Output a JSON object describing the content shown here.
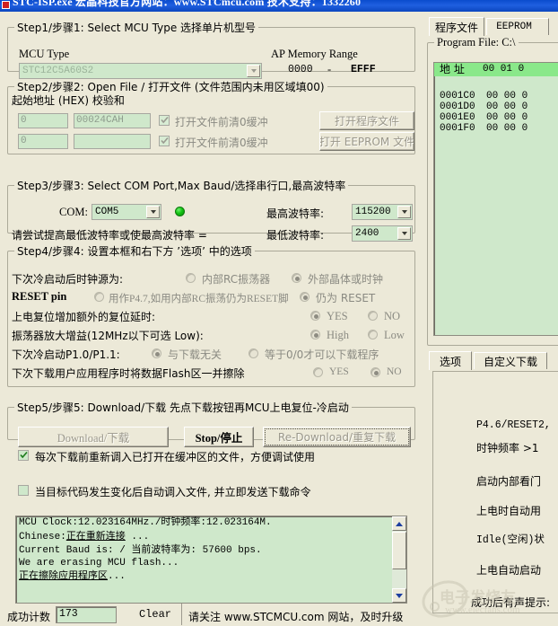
{
  "window": {
    "title": "STC-ISP.exe    宏晶科技官方网站：www.STCmcu.com   技术支持：1332260"
  },
  "step1": {
    "legend": "Step1/步骤1: Select MCU Type  选择单片机型号",
    "mcu_type_label": "MCU Type",
    "mcu_type_value": "STC12C5A60S2",
    "ap_memory_label": "AP Memory Range",
    "ap_start": "0000",
    "ap_dash": "-",
    "ap_end": "EFFF"
  },
  "step2": {
    "legend": "Step2/步骤2: Open File / 打开文件 (文件范围内未用区域填00)",
    "start_addr_label": "起始地址 (HEX)  校验和",
    "row1_addr": "0",
    "row1_checksum": "00024CAH",
    "row1_check_label": "打开文件前清0缓冲",
    "row1_button": "打开程序文件",
    "row2_addr": "0",
    "row2_checksum": "",
    "row2_check_label": "打开文件前清0缓冲",
    "row2_button": "打开 EEPROM 文件"
  },
  "step3": {
    "legend": "Step3/步骤3: Select COM Port,Max Baud/选择串行口,最高波特率",
    "com_label": "COM:",
    "com_value": "COM5",
    "max_baud_label": "最高波特率:",
    "max_baud_value": "115200",
    "hint": "请尝试提高最低波特率或使最高波特率 =",
    "min_baud_label": "最低波特率:",
    "min_baud_value": "2400"
  },
  "step4": {
    "legend": "Step4/步骤4: 设置本框和右下方 ’选项’ 中的选项",
    "rows": [
      {
        "label": "下次冷启动后时钟源为:",
        "opt1": "内部RC振荡器",
        "opt2": "外部晶体或时钟",
        "selected": 2
      },
      {
        "label": "RESET pin",
        "opt1": "用作P4.7,如用内部RC振荡仍为RESET脚",
        "opt2": "仍为 RESET",
        "selected": 2
      },
      {
        "label": "上电复位增加额外的复位延时:",
        "opt1": "YES",
        "opt2": "NO",
        "selected": 1
      },
      {
        "label": "振荡器放大增益(12MHz以下可选 Low):",
        "opt1": "High",
        "opt2": "Low",
        "selected": 1
      },
      {
        "label": "下次冷启动P1.0/P1.1:",
        "opt1": "与下载无关",
        "opt2": "等于0/0才可以下载程序",
        "selected": 1
      },
      {
        "label": "下次下载用户应用程序时将数据Flash区一并擦除",
        "opt1": "YES",
        "opt2": "NO",
        "selected": 2
      }
    ]
  },
  "step5": {
    "legend": "Step5/步骤5: Download/下载   先点下载按钮再MCU上电复位-冷启动",
    "download_button": "Download/下载",
    "stop_button": "Stop/停止",
    "redownload_button": "Re-Download/重复下载",
    "check1": "每次下载前重新调入已打开在缓冲区的文件，方便调试使用",
    "check1_state": true,
    "check2": "当目标代码发生变化后自动调入文件, 并立即发送下载命令",
    "check2_state": false
  },
  "log": {
    "lines": [
      "MCU Clock:12.023164MHz./时钟频率:12.023164M.",
      "Chinese:正在重新连接 ...",
      "Current Baud is: / 当前波特率为: 57600 bps.",
      "We are erasing MCU flash...",
      "正在擦除应用程序区..."
    ]
  },
  "statusbar": {
    "count_label": "成功计数",
    "count_value": "173",
    "clear_button": "Clear",
    "notice": "请关注 www.STCMCU.com 网站，及时升级"
  },
  "rightpanel": {
    "tabs": [
      {
        "label": "程序文件",
        "selected": true
      },
      {
        "label": "EEPROM ",
        "selected": false
      }
    ],
    "program_file_legend": "Program File: C:\\",
    "hex_header_addr": "地 址",
    "hex_header_cols": "00 01 0",
    "hex_rows": [
      {
        "addr": "0001C0",
        "data": "00 00 0"
      },
      {
        "addr": "0001D0",
        "data": "00 00 0"
      },
      {
        "addr": "0001E0",
        "data": "00 00 0"
      },
      {
        "addr": "0001F0",
        "data": "00 00 0"
      }
    ],
    "bottom_tabs": [
      {
        "label": "选项",
        "selected": true
      },
      {
        "label": "自定义下载",
        "selected": false
      }
    ],
    "options": [
      "P4.6/RESET2,",
      "时钟频率 >1",
      "启动内部看门",
      "上电时自动用",
      "Idle(空闲)状",
      "上电自动启动",
      "成功后有声提示:"
    ]
  },
  "watermark": {
    "line1": "电子发烧友",
    "line2": "www.elecfans.com"
  },
  "colors": {
    "titlebar": "#0b4ccd",
    "panel": "#ece9d8",
    "field": "#cfe8cb",
    "hex_header": "#8ae88a",
    "led": "#14c414"
  }
}
